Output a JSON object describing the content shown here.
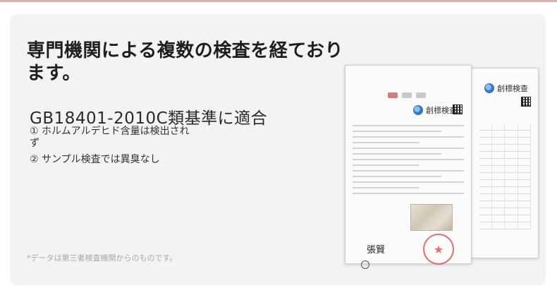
{
  "headline": "専門機関による複数の検査を経ております。",
  "standard": "GB18401-2010C類基準に適合",
  "points": [
    "① ホルムアルデヒド含量は検出されず",
    "② サンプル検査では異臭なし"
  ],
  "footnote": "*データは第三者検査機関からのものです。",
  "documents": {
    "brand": "創標検查",
    "signature": "張賢",
    "stamp_symbol": "★"
  },
  "colors": {
    "card_bg": "#f3f3f3",
    "headline": "#1e1e1e",
    "footnote": "#a8a8a8",
    "stamp": "#e05656",
    "top_rule": "#d8b3aa"
  }
}
